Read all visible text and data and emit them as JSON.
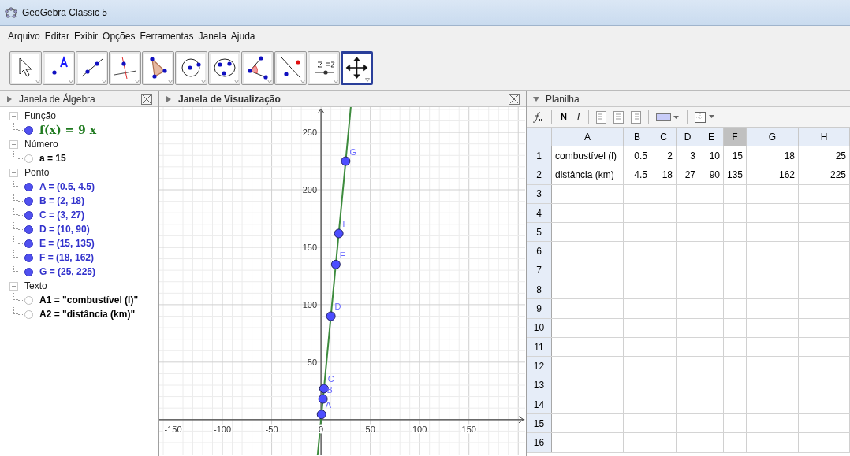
{
  "window": {
    "title": "GeoGebra Classic 5"
  },
  "menu": [
    "Arquivo",
    "Editar",
    "Exibir",
    "Opções",
    "Ferramentas",
    "Janela",
    "Ajuda"
  ],
  "toolbar": [
    {
      "kind": "move",
      "selected": false
    },
    {
      "kind": "point",
      "selected": false
    },
    {
      "kind": "line",
      "selected": false
    },
    {
      "kind": "perpendicular",
      "selected": false
    },
    {
      "kind": "polygon",
      "selected": false
    },
    {
      "kind": "circle",
      "selected": false
    },
    {
      "kind": "conic",
      "selected": false
    },
    {
      "kind": "angle",
      "selected": false
    },
    {
      "kind": "reflect",
      "selected": false
    },
    {
      "kind": "slider",
      "selected": false
    },
    {
      "kind": "pan",
      "selected": true
    }
  ],
  "algebra": {
    "title": "Janela de Álgebra",
    "groups": [
      {
        "label": "Função",
        "expanded": true,
        "items": [
          {
            "text": "f(x) = 9 x",
            "kind": "function",
            "visible": true,
            "color": "#1f7a1f"
          }
        ]
      },
      {
        "label": "Número",
        "expanded": true,
        "items": [
          {
            "text": "a = 15",
            "kind": "plain",
            "visible": false,
            "color": "#000000"
          }
        ]
      },
      {
        "label": "Ponto",
        "expanded": true,
        "items": [
          {
            "text": "A = (0.5, 4.5)",
            "kind": "plain",
            "visible": true,
            "color": "#3333cc"
          },
          {
            "text": "B = (2, 18)",
            "kind": "plain",
            "visible": true,
            "color": "#3333cc"
          },
          {
            "text": "C = (3, 27)",
            "kind": "plain",
            "visible": true,
            "color": "#3333cc"
          },
          {
            "text": "D = (10, 90)",
            "kind": "plain",
            "visible": true,
            "color": "#3333cc"
          },
          {
            "text": "E = (15, 135)",
            "kind": "plain",
            "visible": true,
            "color": "#3333cc"
          },
          {
            "text": "F = (18, 162)",
            "kind": "plain",
            "visible": true,
            "color": "#3333cc"
          },
          {
            "text": "G = (25, 225)",
            "kind": "plain",
            "visible": true,
            "color": "#3333cc"
          }
        ]
      },
      {
        "label": "Texto",
        "expanded": true,
        "items": [
          {
            "text": "A1 = \"combustível (l)\"",
            "kind": "plain",
            "visible": false,
            "color": "#000000"
          },
          {
            "text": "A2 = \"distância (km)\"",
            "kind": "plain",
            "visible": false,
            "color": "#000000"
          }
        ]
      }
    ]
  },
  "graphics": {
    "title": "Janela de Visualização",
    "chart_data": {
      "type": "scatter",
      "grid": true,
      "xlim": [
        -164,
        207
      ],
      "ylim": [
        -31,
        272
      ],
      "xticks": [
        -150,
        -100,
        -50,
        0,
        50,
        100,
        150
      ],
      "yticks": [
        50,
        100,
        150,
        200,
        250
      ],
      "series": [
        {
          "type": "line",
          "color": "#3d8b3d",
          "x": [
            -3.44,
            30.22
          ],
          "values": [
            -31,
            272
          ]
        },
        {
          "color": "#4d4dff",
          "x": [
            0.5,
            2,
            3,
            10,
            15,
            18,
            25
          ],
          "values": [
            4.5,
            18,
            27,
            90,
            135,
            162,
            225
          ]
        }
      ],
      "annotations": [
        {
          "x": 0.5,
          "y": 4.5,
          "text": "A"
        },
        {
          "x": 2,
          "y": 18,
          "text": "B"
        },
        {
          "x": 3,
          "y": 27,
          "text": "C"
        },
        {
          "x": 10,
          "y": 90,
          "text": "D"
        },
        {
          "x": 15,
          "y": 135,
          "text": "E"
        },
        {
          "x": 18,
          "y": 162,
          "text": "F"
        },
        {
          "x": 25,
          "y": 225,
          "text": "G"
        }
      ]
    }
  },
  "spreadsheet": {
    "title": "Planilha",
    "bold": "N",
    "italic": "I",
    "columns": [
      {
        "label": "A",
        "selected": false
      },
      {
        "label": "B",
        "selected": false
      },
      {
        "label": "C",
        "selected": false
      },
      {
        "label": "D",
        "selected": false
      },
      {
        "label": "E",
        "selected": false
      },
      {
        "label": "F",
        "selected": true
      },
      {
        "label": "G",
        "selected": false
      },
      {
        "label": "H",
        "selected": false
      }
    ],
    "rows": [
      {
        "label": "1",
        "cells": [
          "combustível (l)",
          "0.5",
          "2",
          "3",
          "10",
          "15",
          "18",
          "25"
        ]
      },
      {
        "label": "2",
        "cells": [
          "distância (km)",
          "4.5",
          "18",
          "27",
          "90",
          "135",
          "162",
          "225"
        ]
      },
      {
        "label": "3"
      },
      {
        "label": "4"
      },
      {
        "label": "5"
      },
      {
        "label": "6"
      },
      {
        "label": "7"
      },
      {
        "label": "8"
      },
      {
        "label": "9"
      },
      {
        "label": "10"
      },
      {
        "label": "11"
      },
      {
        "label": "12"
      },
      {
        "label": "13"
      },
      {
        "label": "14"
      },
      {
        "label": "15"
      },
      {
        "label": "16"
      }
    ]
  }
}
